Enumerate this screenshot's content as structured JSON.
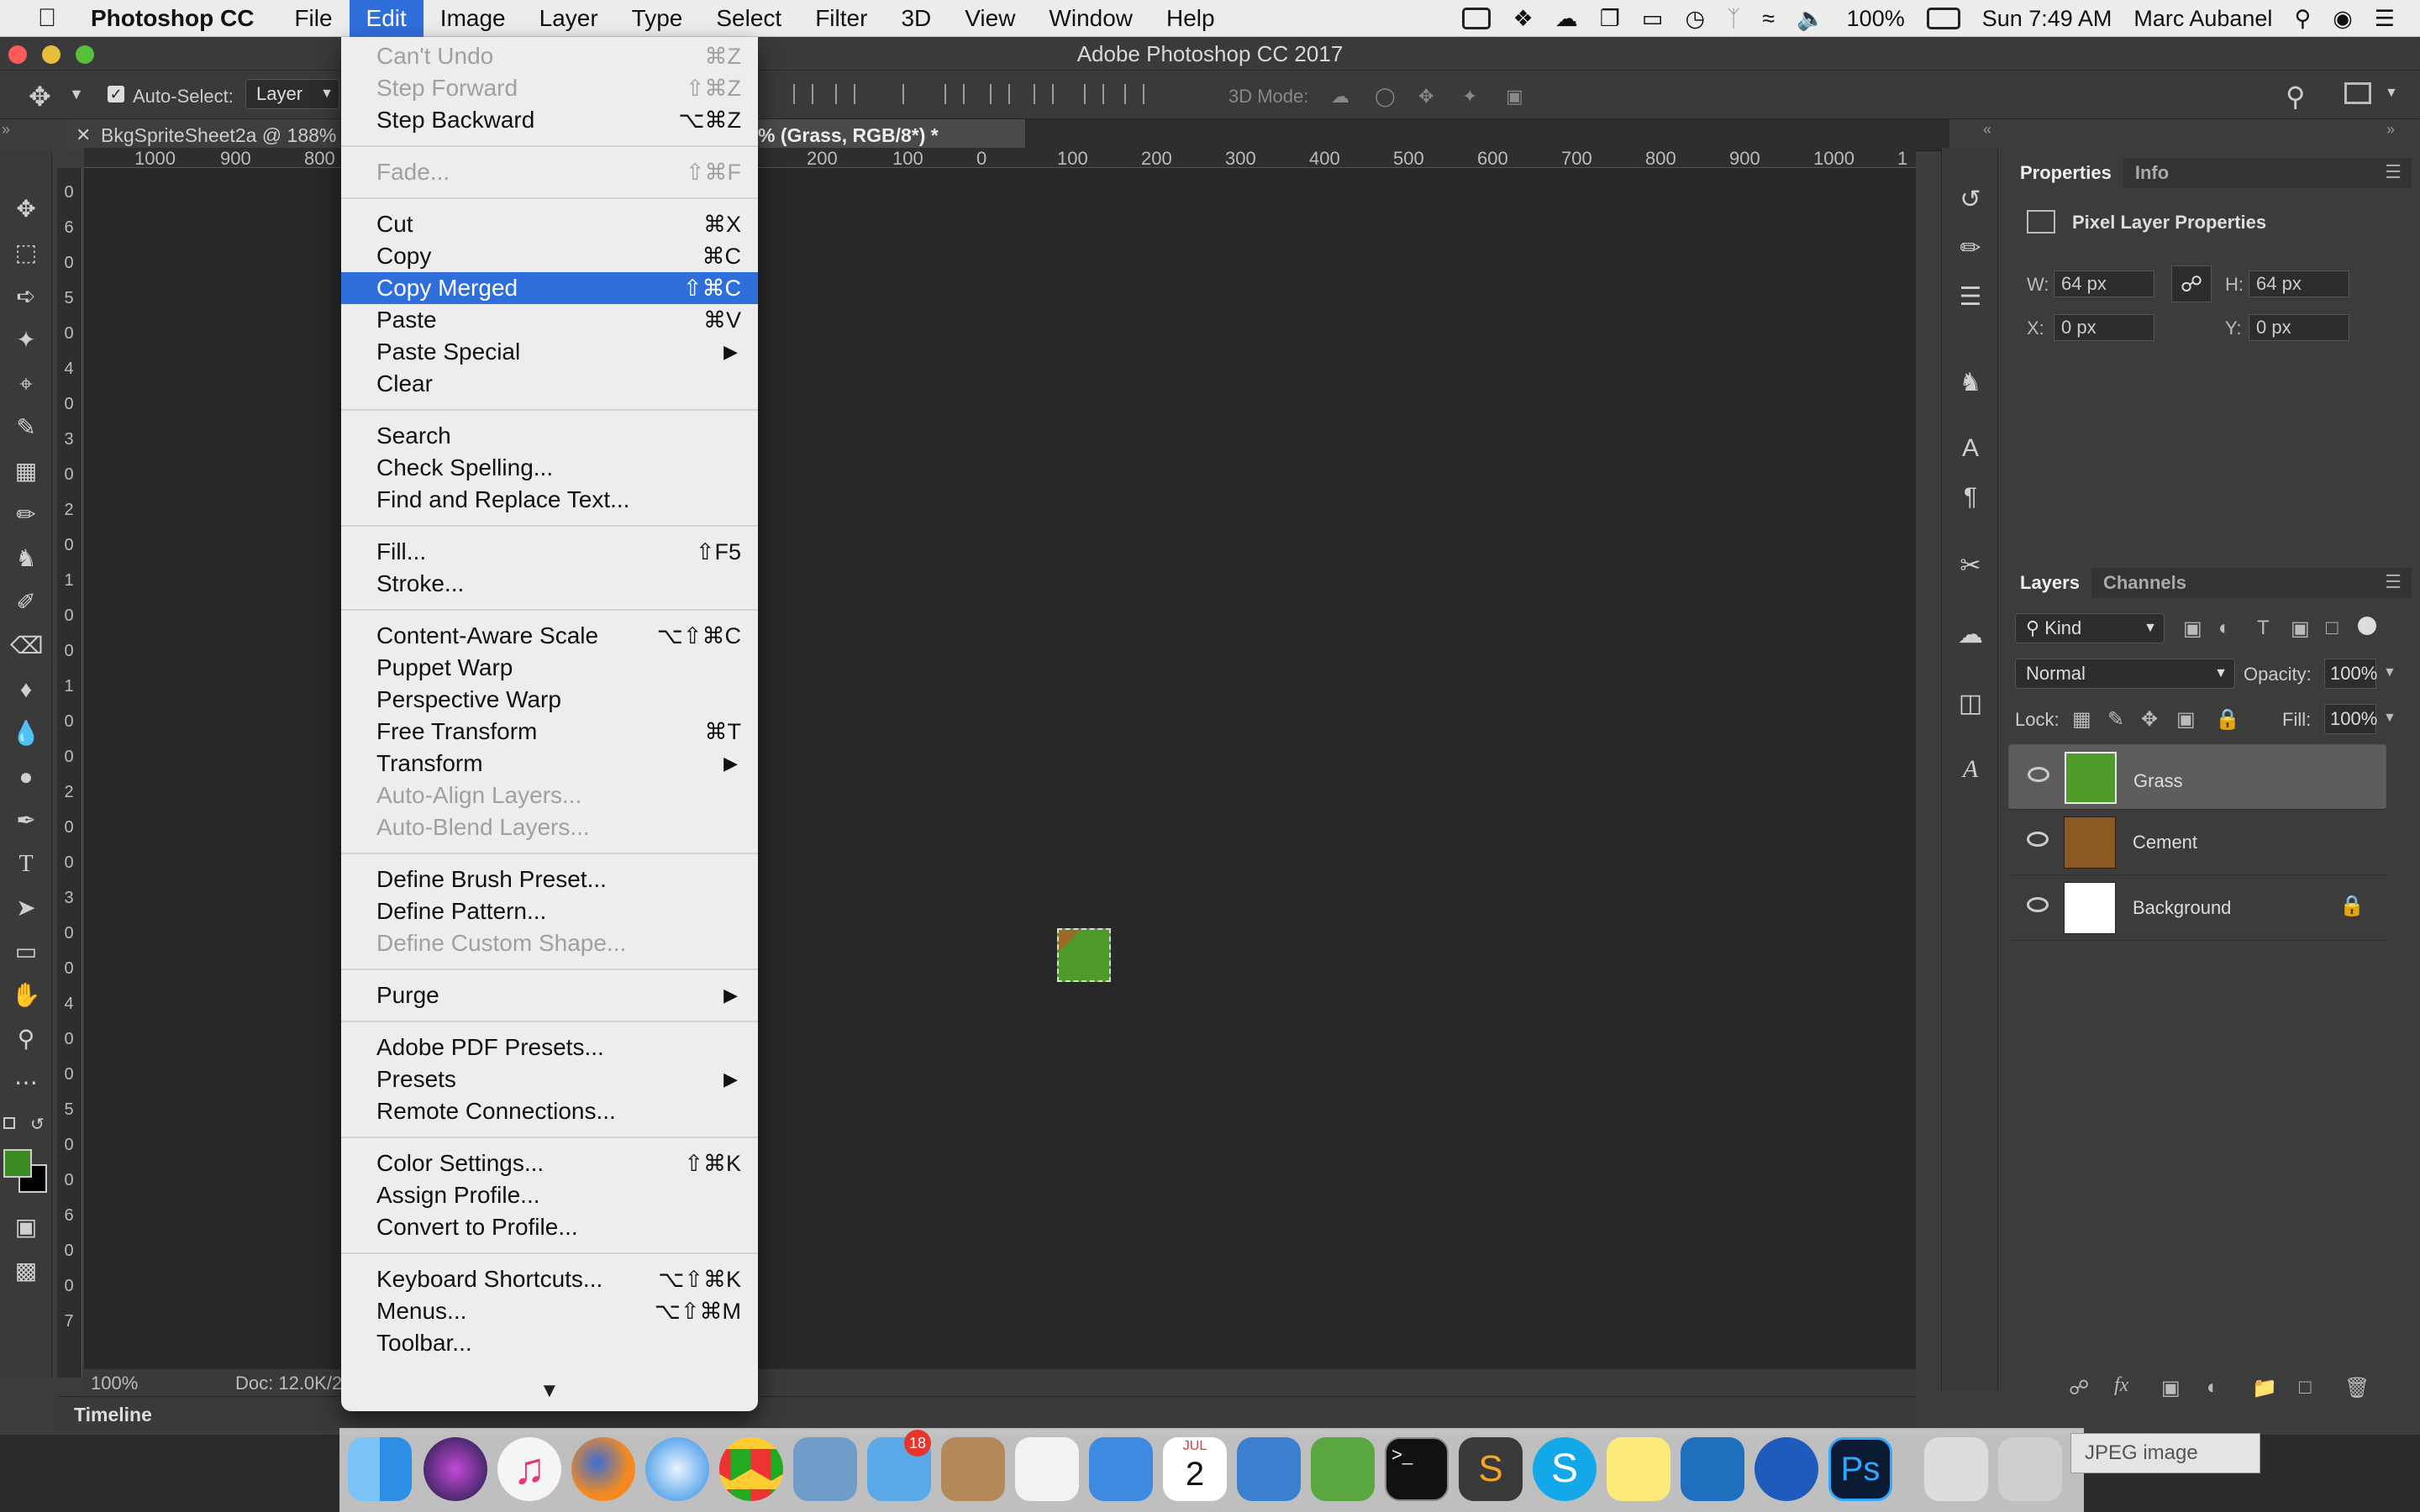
{
  "menubar": {
    "app_name": "Photoshop CC",
    "items": [
      "File",
      "Edit",
      "Image",
      "Layer",
      "Type",
      "Select",
      "Filter",
      "3D",
      "View",
      "Window",
      "Help"
    ],
    "battery": "100%",
    "clock": "Sun 7:49 AM",
    "user": "Marc Aubanel"
  },
  "window": {
    "title": "Adobe Photoshop CC 2017",
    "tab1": "BkgSpriteSheet2a @ 188%",
    "tab2": "% (Grass, RGB/8*) *"
  },
  "options": {
    "auto_select_label": "Auto-Select:",
    "auto_select_value": "Layer",
    "mode3d_label": "3D Mode:"
  },
  "ruler": {
    "h": [
      "1000",
      "900",
      "800",
      "200",
      "100",
      "0",
      "100",
      "200",
      "300",
      "400",
      "500",
      "600",
      "700",
      "800",
      "900",
      "1000",
      "1"
    ],
    "v": [
      "0",
      "6",
      "0",
      "5",
      "0",
      "4",
      "0",
      "3",
      "0",
      "2",
      "0",
      "1",
      "0",
      "0",
      "1",
      "0",
      "0",
      "2",
      "0",
      "0",
      "3",
      "0",
      "0",
      "4",
      "0",
      "0",
      "5",
      "0",
      "0",
      "6",
      "0",
      "0",
      "7"
    ]
  },
  "status": {
    "zoom": "100%",
    "doc": "Doc: 12.0K/2"
  },
  "timeline_label": "Timeline",
  "edit_menu": {
    "groups": [
      [
        {
          "label": "Can't Undo",
          "shortcut": "⌘Z",
          "disabled": true
        },
        {
          "label": "Step Forward",
          "shortcut": "⇧⌘Z",
          "disabled": true
        },
        {
          "label": "Step Backward",
          "shortcut": "⌥⌘Z"
        }
      ],
      [
        {
          "label": "Fade...",
          "shortcut": "⇧⌘F",
          "disabled": true
        }
      ],
      [
        {
          "label": "Cut",
          "shortcut": "⌘X"
        },
        {
          "label": "Copy",
          "shortcut": "⌘C"
        },
        {
          "label": "Copy Merged",
          "shortcut": "⇧⌘C",
          "highlighted": true
        },
        {
          "label": "Paste",
          "shortcut": "⌘V"
        },
        {
          "label": "Paste Special",
          "submenu": true
        },
        {
          "label": "Clear"
        }
      ],
      [
        {
          "label": "Search"
        },
        {
          "label": "Check Spelling..."
        },
        {
          "label": "Find and Replace Text..."
        }
      ],
      [
        {
          "label": "Fill...",
          "shortcut": "⇧F5"
        },
        {
          "label": "Stroke..."
        }
      ],
      [
        {
          "label": "Content-Aware Scale",
          "shortcut": "⌥⇧⌘C"
        },
        {
          "label": "Puppet Warp"
        },
        {
          "label": "Perspective Warp"
        },
        {
          "label": "Free Transform",
          "shortcut": "⌘T"
        },
        {
          "label": "Transform",
          "submenu": true
        },
        {
          "label": "Auto-Align Layers...",
          "disabled": true
        },
        {
          "label": "Auto-Blend Layers...",
          "disabled": true
        }
      ],
      [
        {
          "label": "Define Brush Preset..."
        },
        {
          "label": "Define Pattern..."
        },
        {
          "label": "Define Custom Shape...",
          "disabled": true
        }
      ],
      [
        {
          "label": "Purge",
          "submenu": true
        }
      ],
      [
        {
          "label": "Adobe PDF Presets..."
        },
        {
          "label": "Presets",
          "submenu": true
        },
        {
          "label": "Remote Connections..."
        }
      ],
      [
        {
          "label": "Color Settings...",
          "shortcut": "⇧⌘K"
        },
        {
          "label": "Assign Profile..."
        },
        {
          "label": "Convert to Profile..."
        }
      ],
      [
        {
          "label": "Keyboard Shortcuts...",
          "shortcut": "⌥⇧⌘K"
        },
        {
          "label": "Menus...",
          "shortcut": "⌥⇧⌘M"
        },
        {
          "label": "Toolbar..."
        }
      ]
    ]
  },
  "properties": {
    "tab_active": "Properties",
    "tab_other": "Info",
    "heading": "Pixel Layer Properties",
    "w_label": "W:",
    "w_value": "64 px",
    "h_label": "H:",
    "h_value": "64 px",
    "x_label": "X:",
    "x_value": "0 px",
    "y_label": "Y:",
    "y_value": "0 px"
  },
  "layers_panel": {
    "tab_active": "Layers",
    "tab_other": "Channels",
    "filter": "Kind",
    "blend_mode": "Normal",
    "opacity_label": "Opacity:",
    "opacity_value": "100%",
    "lock_label": "Lock:",
    "fill_label": "Fill:",
    "fill_value": "100%",
    "layers": [
      {
        "name": "Grass",
        "selected": true,
        "thumb_color": "#4e9a2a"
      },
      {
        "name": "Cement",
        "selected": false,
        "thumb_color": "#8b5a22"
      },
      {
        "name": "Background",
        "selected": false,
        "thumb_color": "#ffffff",
        "locked": true
      }
    ]
  },
  "dock": {
    "mail_badge": "18",
    "jpeg_label": "JPEG image",
    "calendar_month": "JUL",
    "calendar_day": "2"
  },
  "colors": {
    "menu_highlight": "#2f6fdc",
    "foreground_swatch": "#3c8a22",
    "background_swatch": "#000000"
  }
}
